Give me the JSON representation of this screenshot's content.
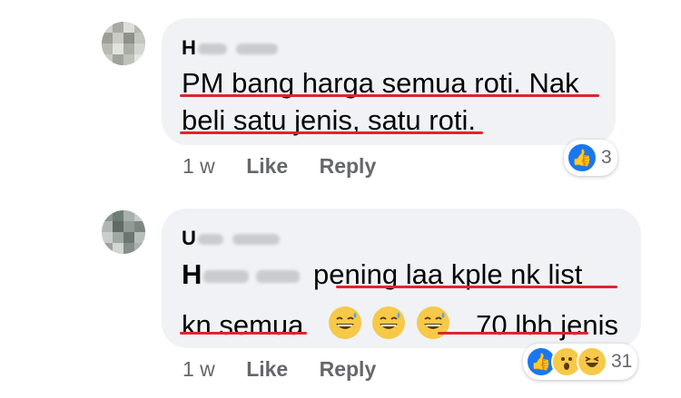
{
  "comments": [
    {
      "author_initial": "H",
      "lines": [
        "PM bang harga semua roti. Nak",
        "beli satu jenis, satu roti."
      ],
      "time": "1 w",
      "like_label": "Like",
      "reply_label": "Reply",
      "reaction_count": "3",
      "reactions": [
        "like-icon"
      ]
    },
    {
      "author_initial": "U",
      "mention_initial": "H",
      "line1_text": "pening laa kple nk list",
      "line2_text_a": "kn semua",
      "line2_text_b": "70 lbh jenis",
      "time": "1 w",
      "like_label": "Like",
      "reply_label": "Reply",
      "reaction_count": "31",
      "reactions": [
        "like-icon",
        "wow-icon",
        "haha-icon"
      ]
    }
  ],
  "colors": {
    "bubble": "#f0f2f5",
    "underline": "#e0242d",
    "like": "#1877f2",
    "meta": "#65676b"
  }
}
